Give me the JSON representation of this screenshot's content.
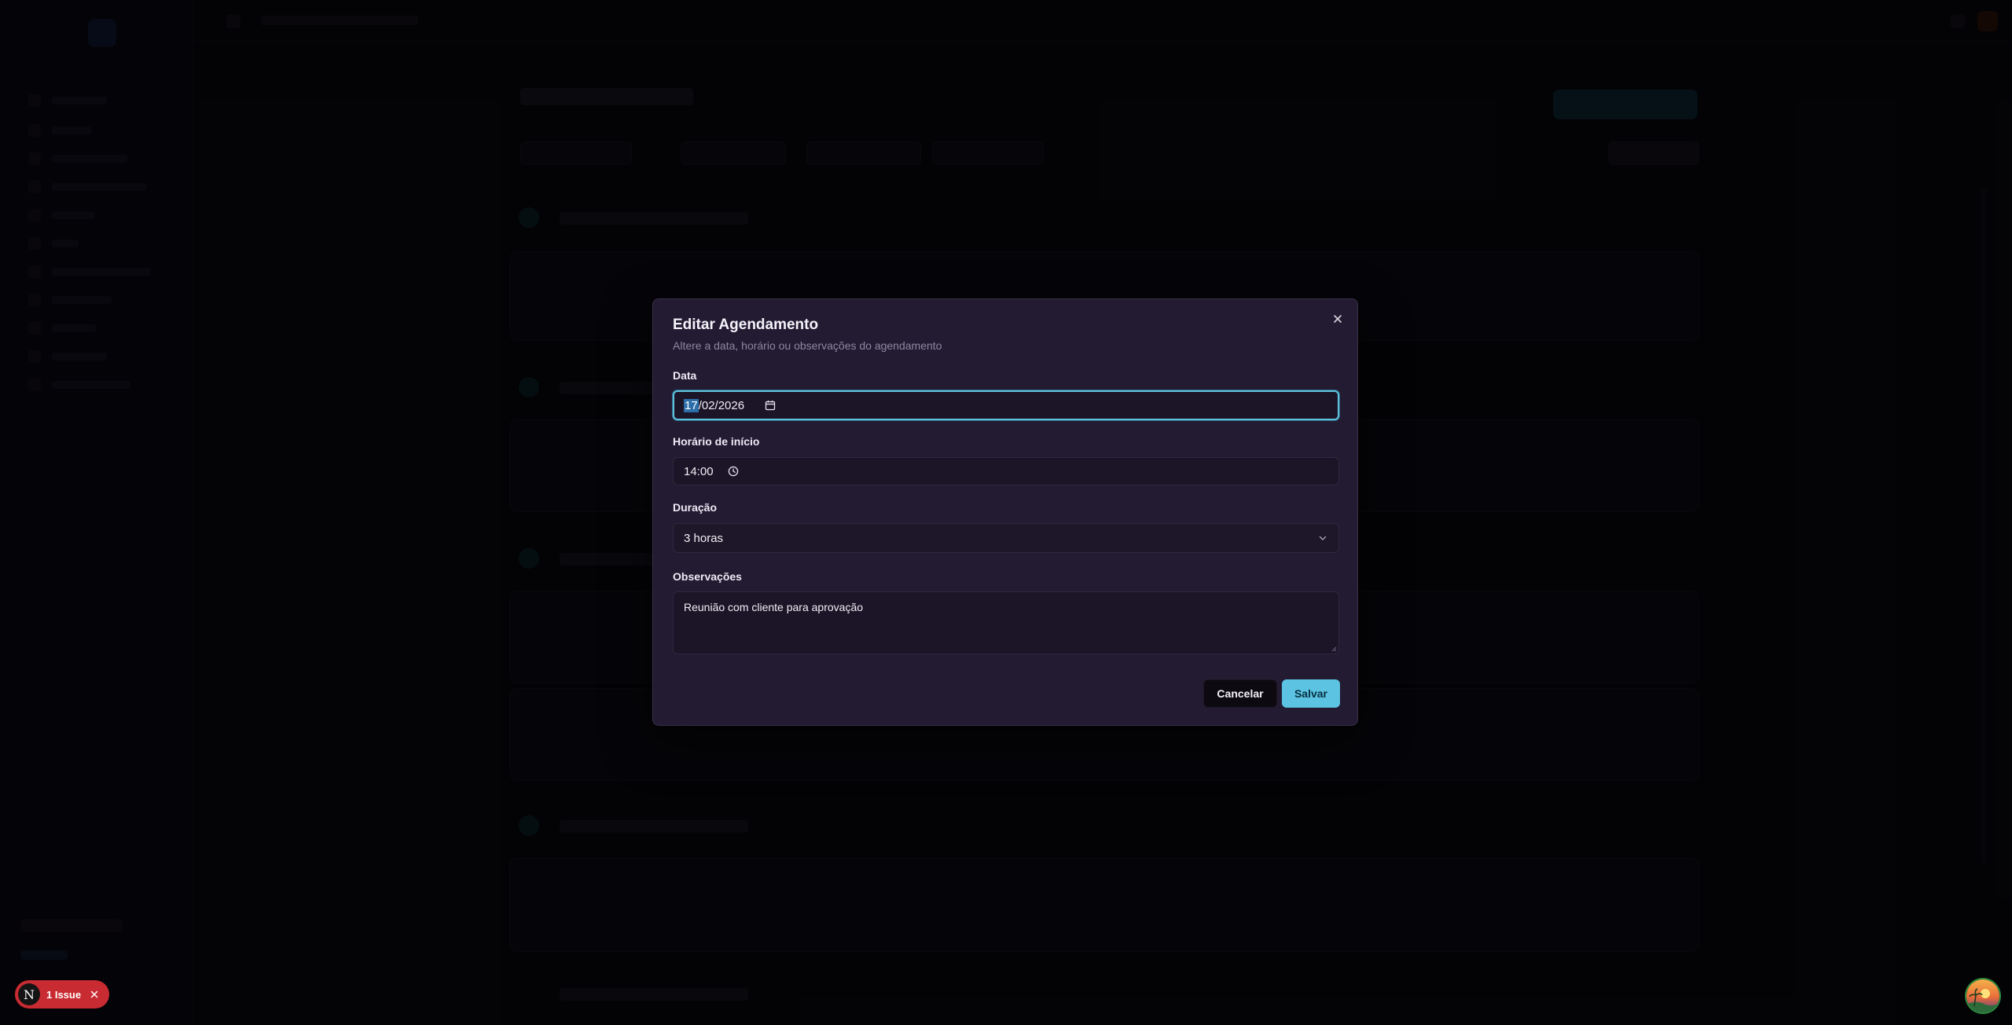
{
  "modal": {
    "title": "Editar Agendamento",
    "description": "Altere a data, horário ou observações do agendamento",
    "close_icon": "x-icon",
    "fields": {
      "date": {
        "label": "Data",
        "day": "17",
        "month": "02",
        "year": "2026",
        "icon": "calendar-icon"
      },
      "start_time": {
        "label": "Horário de início",
        "value": "14:00",
        "icon": "clock-icon"
      },
      "duration": {
        "label": "Duração",
        "value": "3 horas",
        "icon": "chevron-down-icon"
      },
      "notes": {
        "label": "Observações",
        "value": "Reunião com cliente para aprovação"
      }
    },
    "buttons": {
      "cancel": "Cancelar",
      "save": "Salvar"
    }
  },
  "issue_badge": {
    "letter": "N",
    "text": "1 Issue"
  },
  "colors": {
    "accent": "#5cc3e3",
    "modal_bg": "#231b32",
    "danger": "#c92b32"
  }
}
